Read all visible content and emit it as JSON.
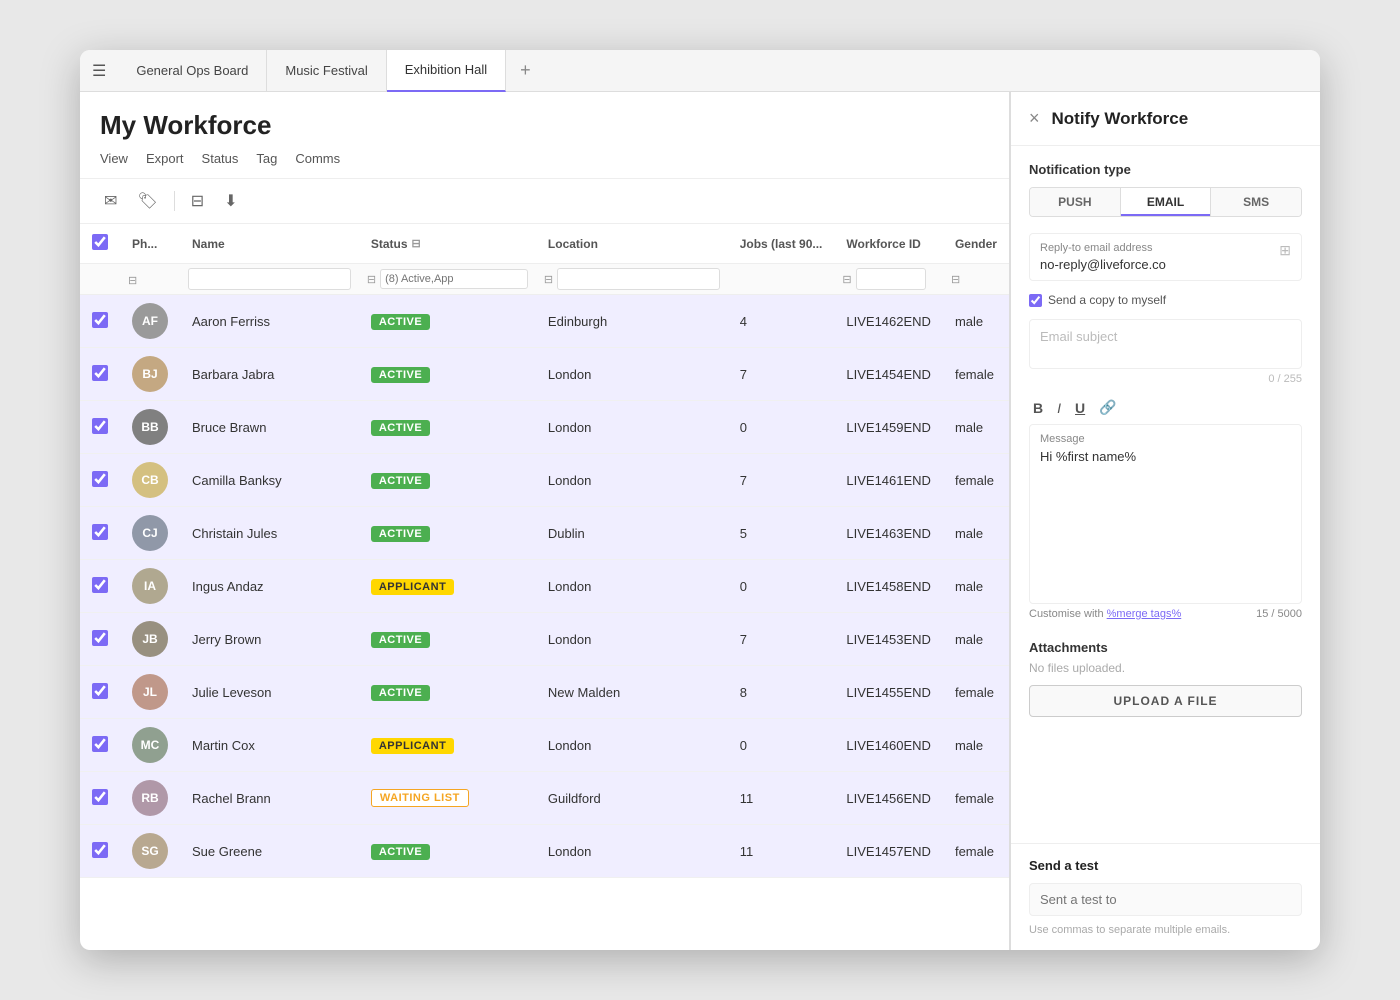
{
  "window": {
    "tabs": [
      {
        "label": "General Ops Board",
        "active": false
      },
      {
        "label": "Music Festival",
        "active": false
      },
      {
        "label": "Exhibition Hall",
        "active": true
      }
    ],
    "tab_add": "+"
  },
  "page": {
    "title": "My Workforce",
    "nav": [
      "View",
      "Export",
      "Status",
      "Tag",
      "Comms"
    ]
  },
  "toolbar": {
    "icons": [
      "send",
      "tag",
      "filter",
      "download"
    ]
  },
  "table": {
    "columns": [
      "Ph...",
      "Name",
      "Status",
      "Location",
      "Jobs (last 90...",
      "Workforce ID",
      "Gender"
    ],
    "filter_status_placeholder": "(8) Active,App",
    "rows": [
      {
        "name": "Aaron Ferriss",
        "status": "ACTIVE",
        "status_type": "active",
        "location": "Edinburgh",
        "jobs": "4",
        "id": "LIVE1462END",
        "gender": "male",
        "av": "av1"
      },
      {
        "name": "Barbara Jabra",
        "status": "ACTIVE",
        "status_type": "active",
        "location": "London",
        "jobs": "7",
        "id": "LIVE1454END",
        "gender": "female",
        "av": "av2"
      },
      {
        "name": "Bruce Brawn",
        "status": "ACTIVE",
        "status_type": "active",
        "location": "London",
        "jobs": "0",
        "id": "LIVE1459END",
        "gender": "male",
        "av": "av3"
      },
      {
        "name": "Camilla Banksy",
        "status": "ACTIVE",
        "status_type": "active",
        "location": "London",
        "jobs": "7",
        "id": "LIVE1461END",
        "gender": "female",
        "av": "av4"
      },
      {
        "name": "Christain Jules",
        "status": "ACTIVE",
        "status_type": "active",
        "location": "Dublin",
        "jobs": "5",
        "id": "LIVE1463END",
        "gender": "male",
        "av": "av5"
      },
      {
        "name": "Ingus Andaz",
        "status": "APPLICANT",
        "status_type": "applicant",
        "location": "London",
        "jobs": "0",
        "id": "LIVE1458END",
        "gender": "male",
        "av": "av6"
      },
      {
        "name": "Jerry Brown",
        "status": "ACTIVE",
        "status_type": "active",
        "location": "London",
        "jobs": "7",
        "id": "LIVE1453END",
        "gender": "male",
        "av": "av7"
      },
      {
        "name": "Julie Leveson",
        "status": "ACTIVE",
        "status_type": "active",
        "location": "New Malden",
        "jobs": "8",
        "id": "LIVE1455END",
        "gender": "female",
        "av": "av8"
      },
      {
        "name": "Martin Cox",
        "status": "APPLICANT",
        "status_type": "applicant",
        "location": "London",
        "jobs": "0",
        "id": "LIVE1460END",
        "gender": "male",
        "av": "av9"
      },
      {
        "name": "Rachel Brann",
        "status": "WAITING LIST",
        "status_type": "waiting",
        "location": "Guildford",
        "jobs": "11",
        "id": "LIVE1456END",
        "gender": "female",
        "av": "av10"
      },
      {
        "name": "Sue Greene",
        "status": "ACTIVE",
        "status_type": "active",
        "location": "London",
        "jobs": "11",
        "id": "LIVE1457END",
        "gender": "female",
        "av": "av11"
      }
    ]
  },
  "notify": {
    "title": "Notify Workforce",
    "close_label": "×",
    "notification_type_label": "Notification type",
    "tabs": [
      {
        "label": "PUSH",
        "active": false
      },
      {
        "label": "EMAIL",
        "active": true
      },
      {
        "label": "SMS",
        "active": false
      }
    ],
    "reply_to_label": "Reply-to email address",
    "reply_to_value": "no-reply@liveforce.co",
    "send_copy_label": "Send a copy to myself",
    "email_subject_placeholder": "Email subject",
    "char_count": "0 / 255",
    "format_buttons": [
      "B",
      "I",
      "U",
      "🔗"
    ],
    "message_label": "Message",
    "message_content": "Hi %first name%",
    "customize_prefix": "Customise with ",
    "merge_tags_label": "%merge tags%",
    "message_char_count": "15 / 5000",
    "attachments_label": "Attachments",
    "no_files_label": "No files uploaded.",
    "upload_btn_label": "UPLOAD A FILE",
    "send_test_label": "Send a test",
    "send_test_placeholder": "Sent a test to",
    "send_test_hint": "Use commas to separate multiple emails."
  }
}
